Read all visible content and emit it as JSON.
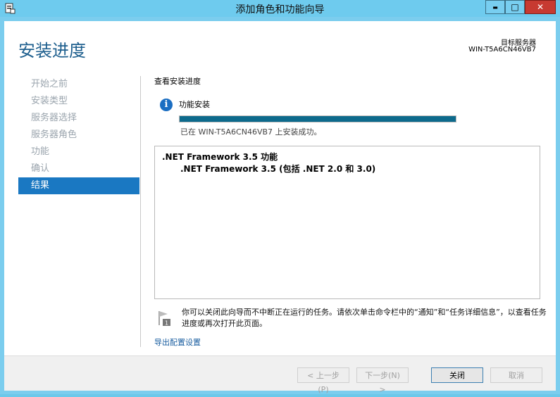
{
  "window": {
    "title": "添加角色和功能向导",
    "controls": {
      "minimize": "▬",
      "maximize": "□",
      "close": "✕"
    }
  },
  "header": {
    "page_title": "安装进度",
    "destination_label": "目标服务器",
    "destination_server": "WIN-T5A6CN46VB7"
  },
  "nav": {
    "items": [
      {
        "label": "开始之前",
        "active": false
      },
      {
        "label": "安装类型",
        "active": false
      },
      {
        "label": "服务器选择",
        "active": false
      },
      {
        "label": "服务器角色",
        "active": false
      },
      {
        "label": "功能",
        "active": false
      },
      {
        "label": "确认",
        "active": false
      },
      {
        "label": "结果",
        "active": true
      }
    ]
  },
  "main": {
    "section_header": "查看安装进度",
    "info_icon": "info-icon",
    "feature_label": "功能安装",
    "progress_fraction": 1.0,
    "status_text": "已在 WIN-T5A6CN46VB7 上安装成功。",
    "results": [
      ".NET Framework 3.5 功能",
      ".NET Framework 3.5 (包括 .NET 2.0 和 3.0)"
    ],
    "note": "你可以关闭此向导而不中断正在运行的任务。请依次单击命令栏中的“通知”和“任务详细信息”，以查看任务进度或再次打开此页面。",
    "export_link": "导出配置设置"
  },
  "footer": {
    "prev_label": "< 上一步(P)",
    "next_label": "下一步(N) >",
    "close_label": "关闭",
    "cancel_label": "取消"
  },
  "colors": {
    "accent": "#1a78c2",
    "title_blue": "#1e5f8e",
    "progress": "#0d6a8c",
    "frame": "#6ecbee"
  }
}
